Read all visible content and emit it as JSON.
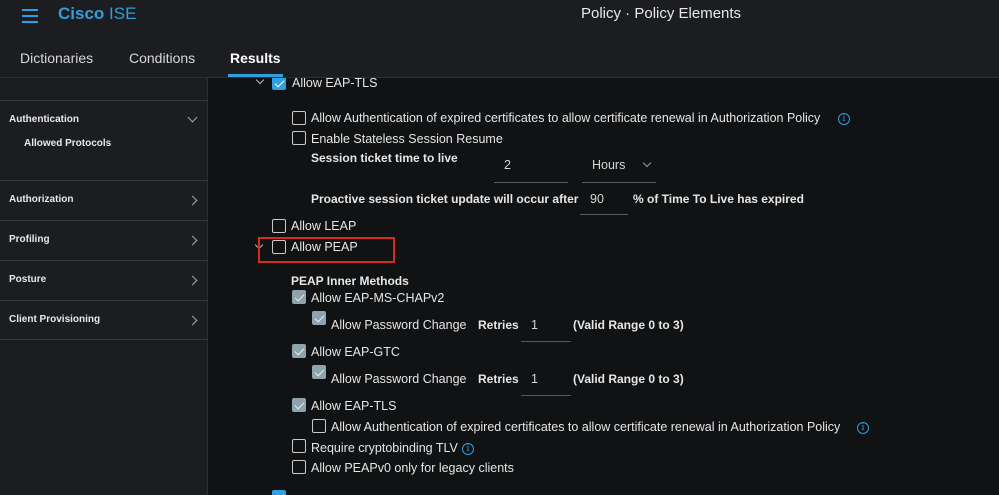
{
  "header": {
    "brand_bold": "Cisco",
    "brand_rest": " ISE",
    "title": "Policy · Policy Elements"
  },
  "tabs": [
    {
      "label": "Dictionaries"
    },
    {
      "label": "Conditions"
    },
    {
      "label": "Results"
    }
  ],
  "sidebar": {
    "authentication": "Authentication",
    "allowed_protocols": "Allowed Protocols",
    "authorization": "Authorization",
    "profiling": "Profiling",
    "posture": "Posture",
    "client_provisioning": "Client Provisioning"
  },
  "main": {
    "allow_eap_tls_top": "Allow EAP-TLS",
    "allow_auth_expired_1": "Allow Authentication of expired certificates to allow certificate renewal in Authorization Policy",
    "enable_stateless": "Enable Stateless Session Resume",
    "session_ticket_label": "Session ticket time to live",
    "session_ticket_value": "2",
    "session_ticket_unit": "Hours",
    "proactive_label": "Proactive session ticket update will occur after",
    "proactive_value": "90",
    "proactive_suffix": "% of Time To Live has expired",
    "allow_leap": "Allow LEAP",
    "allow_peap": "Allow PEAP",
    "peap_inner_methods": "PEAP Inner Methods",
    "allow_eap_ms_chapv2": "Allow EAP-MS-CHAPv2",
    "allow_password_change_1": "Allow Password Change",
    "retries_label_1": "Retries",
    "retries_value_1": "1",
    "valid_range_1": "(Valid Range 0 to 3)",
    "allow_eap_gtc": "Allow EAP-GTC",
    "allow_password_change_2": "Allow Password Change",
    "retries_label_2": "Retries",
    "retries_value_2": "1",
    "valid_range_2": "(Valid Range 0 to 3)",
    "allow_eap_tls_inner": "Allow EAP-TLS",
    "allow_auth_expired_2": "Allow Authentication of expired certificates to allow certificate renewal in Authorization Policy",
    "require_cryptobinding": "Require cryptobinding TLV",
    "allow_peapv0": "Allow PEAPv0 only for legacy clients"
  },
  "colors": {
    "accent": "#2f9fe0",
    "highlight": "#d42a2a",
    "checked_fill": "#8fa3ad"
  }
}
